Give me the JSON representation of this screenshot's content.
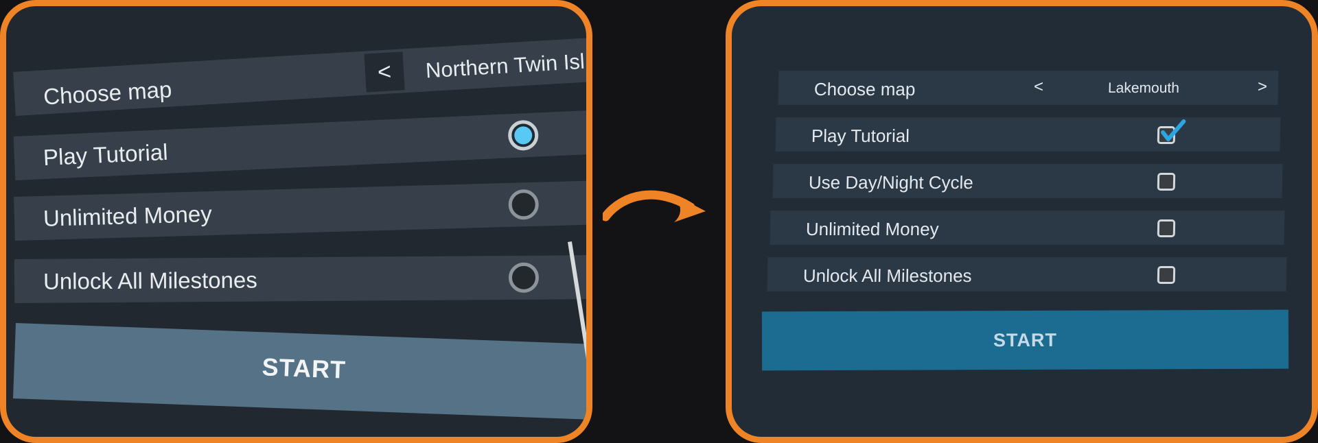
{
  "before": {
    "choose_map_label": "Choose map",
    "prev_symbol": "<",
    "map_value": "Northern Twin Isl",
    "options": [
      {
        "label": "Play Tutorial",
        "selected": true
      },
      {
        "label": "Unlimited Money",
        "selected": false
      },
      {
        "label": "Unlock All Milestones",
        "selected": false
      }
    ],
    "start_label": "START"
  },
  "after": {
    "choose_map_label": "Choose map",
    "prev_symbol": "<",
    "map_value": "Lakemouth",
    "next_symbol": ">",
    "options": [
      {
        "label": "Play Tutorial",
        "checked": true
      },
      {
        "label": "Use Day/Night Cycle",
        "checked": false
      },
      {
        "label": "Unlimited Money",
        "checked": false
      },
      {
        "label": "Unlock All Milestones",
        "checked": false
      }
    ],
    "start_label": "START"
  },
  "colors": {
    "frame_border": "#ef8427",
    "arrow": "#ef8427",
    "before_start": "#557287",
    "after_start": "#1b6c90",
    "radio_selected": "#59c8f5",
    "checkbox_tick": "#2aa6e0"
  },
  "icons": {
    "transition": "curved-arrow-icon",
    "selected_radio": "radio-selected-icon",
    "checked_box": "checkbox-checked-icon"
  }
}
